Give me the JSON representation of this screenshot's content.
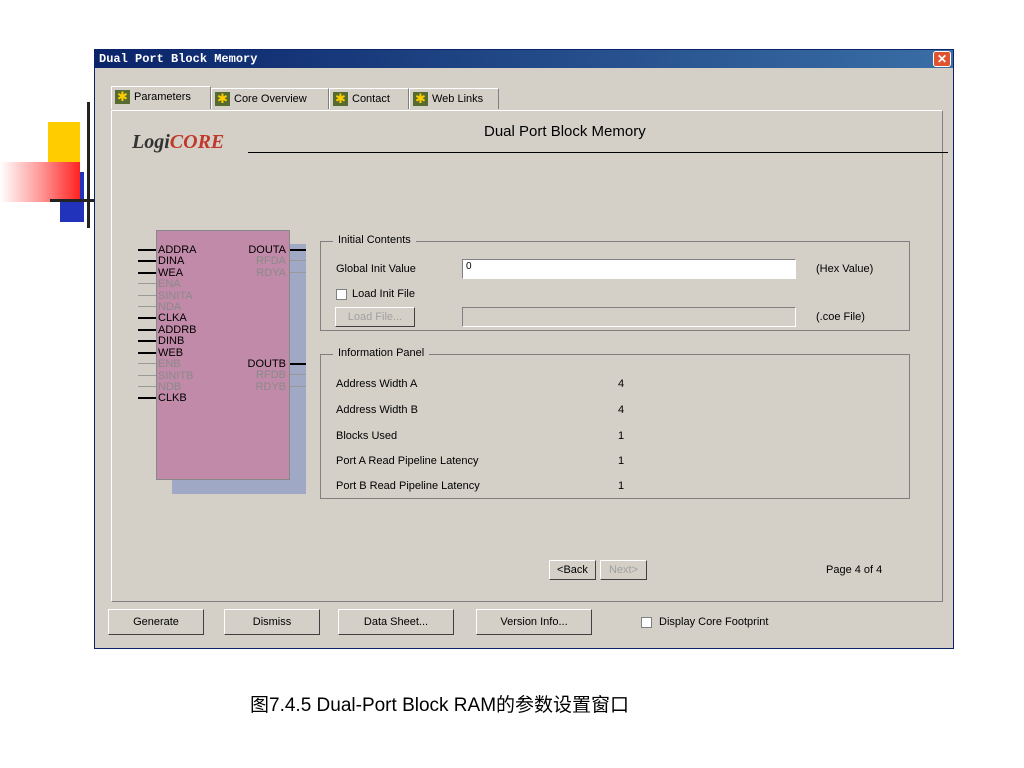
{
  "window": {
    "title": "Dual Port Block Memory",
    "close_glyph": "✕"
  },
  "tabs": [
    {
      "label": "Parameters",
      "active": true
    },
    {
      "label": "Core Overview"
    },
    {
      "label": "Contact"
    },
    {
      "label": "Web Links"
    }
  ],
  "header": {
    "logo_prefix": "Logi",
    "logo_suffix": "CORE",
    "title": "Dual Port Block Memory"
  },
  "symbol": {
    "left_pins_a": [
      "ADDRA",
      "DINA",
      "WEA",
      "ENA",
      "SINITA",
      "NDA",
      "CLKA"
    ],
    "right_pins_a": [
      "DOUTA",
      "RFDA",
      "RDYA"
    ],
    "left_pins_b": [
      "ADDRB",
      "DINB",
      "WEB",
      "ENB",
      "SINITB",
      "NDB",
      "CLKB"
    ],
    "right_pins_b": [
      "DOUTB",
      "RFDB",
      "RDYB"
    ]
  },
  "initial_contents": {
    "legend": "Initial Contents",
    "global_init_label": "Global Init Value",
    "global_init_value": "0",
    "global_init_unit": "(Hex Value)",
    "load_init_label": "Load Init File",
    "load_init_checked": false,
    "load_file_button": "Load File...",
    "load_file_value": "",
    "load_file_unit": "(.coe File)"
  },
  "information_panel": {
    "legend": "Information Panel",
    "rows": [
      {
        "label": "Address Width A",
        "value": "4"
      },
      {
        "label": "Address Width B",
        "value": "4"
      },
      {
        "label": "Blocks Used",
        "value": "1"
      },
      {
        "label": "Port A Read Pipeline Latency",
        "value": "1"
      },
      {
        "label": "Port B Read Pipeline Latency",
        "value": "1"
      }
    ]
  },
  "navigation": {
    "back": "<Back",
    "next": "Next>",
    "page": "Page 4 of 4"
  },
  "footer": {
    "generate": "Generate",
    "dismiss": "Dismiss",
    "data_sheet": "Data Sheet...",
    "version_info": "Version Info...",
    "display_footprint": "Display Core Footprint",
    "display_footprint_checked": false
  },
  "caption": "图7.4.5 Dual-Port Block RAM的参数设置窗口",
  "colors": {
    "title_bar": "#0a246a",
    "window_bg": "#d4d0c8",
    "symbol_fill": "#c08aa8",
    "symbol_shadow": "#9fa8c4"
  }
}
